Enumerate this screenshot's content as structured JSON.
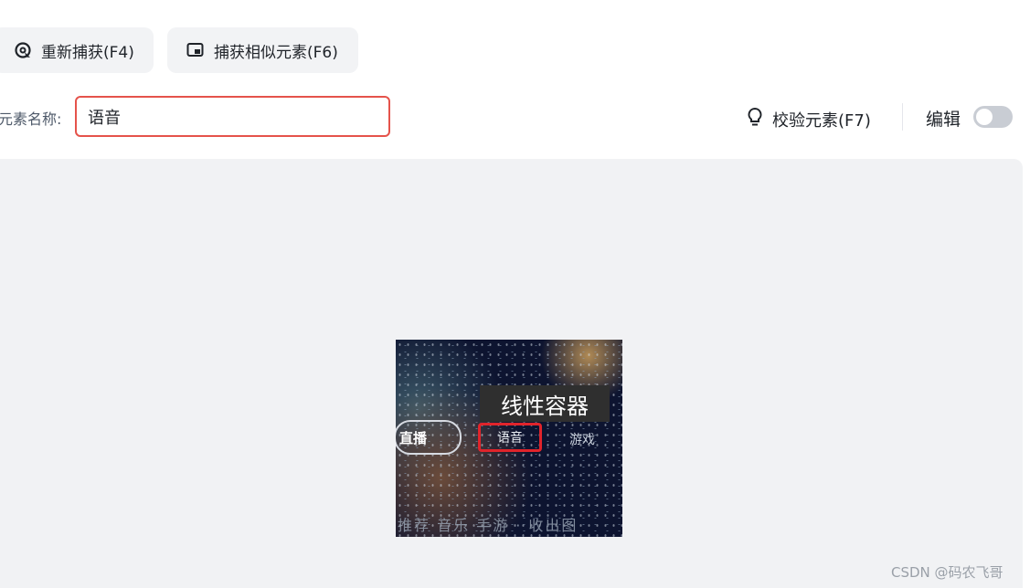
{
  "toolbar": {
    "recapture_label": "重新捕获(F4)",
    "capture_similar_label": "捕获相似元素(F6)"
  },
  "form": {
    "element_name_label": "元素名称:",
    "element_name_value": "语音"
  },
  "actions": {
    "verify_label": "校验元素(F7)",
    "edit_label": "编辑",
    "edit_enabled": false
  },
  "preview": {
    "tooltip": "线性容器",
    "tab_live": "直播",
    "tab_voice": "语音",
    "tab_game": "游戏",
    "bottom_text": "推荐 音乐 手游 · 收出图"
  },
  "watermark": "CSDN @码农飞哥",
  "colors": {
    "input_border": "#e5534b",
    "button_bg": "#f2f3f5",
    "preview_bg": "#f1f2f4",
    "toggle_off": "#c9cdd4",
    "highlight_red": "#e0242b"
  }
}
